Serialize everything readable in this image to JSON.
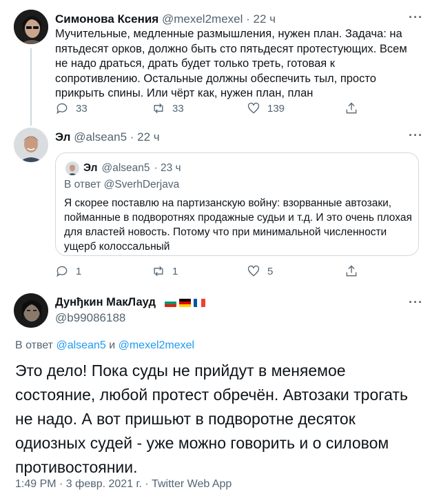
{
  "tweet1": {
    "name": "Симонова Ксения",
    "handle": "@mexel2mexel",
    "time": "· 22 ч",
    "more": "···",
    "text": "Мучительные, медленные размышления, нужен план. Задача: на пятьдесят орков, должно быть сто пятьдесят протестующих. Всем не надо драться, драть будет только треть, готовая к сопротивлению. Остальные должны обеспечить тыл, просто прикрыть спины. Или чёрт как, нужен план, план",
    "replies": "33",
    "retweets": "33",
    "likes": "139",
    "share": ""
  },
  "tweet2": {
    "name": "Эл",
    "handle": "@alsean5",
    "time": "· 22 ч",
    "more": "···",
    "quote": {
      "name": "Эл",
      "handle": "@alsean5",
      "time": "· 23 ч",
      "reply_to": "В ответ @SverhDerjava",
      "text": "Я скорее поставлю на партизанскую войну: взорванные автозаки, пойманные в подворотнях продажные судьи и т.д. И это очень плохая для властей новость. Потому что при минимальной численности ущерб колоссальный"
    },
    "replies": "1",
    "retweets": "1",
    "likes": "5"
  },
  "tweet3": {
    "name": "Дунђкин МакЛауд",
    "handle": "@b99086188",
    "more": "···",
    "reply_prefix": "В ответ",
    "reply_user1": "@alsean5",
    "reply_and": "и",
    "reply_user2": "@mexel2mexel",
    "text": "Это дело! Пока суды не прийдут в меняемое состояние, любой протест обречён. Автозаки трогать не надо. А вот пришьют в подворотне десяток одиозных судей - уже можно говорить и о силовом противостоянии.",
    "meta": "1:49 PM · 3 февр. 2021 г. · Twitter Web App"
  },
  "colors": {
    "text": "#0f1419",
    "muted": "#536471",
    "link": "#1d9bf0",
    "border": "#cfd9de"
  },
  "icons": {
    "reply": "speech-bubble-icon",
    "retweet": "retweet-arrows-icon",
    "like": "heart-icon",
    "share": "share-upload-icon",
    "more": "more-dots-icon",
    "flags": [
      "bulgaria-flag-icon",
      "germany-flag-icon",
      "france-flag-icon"
    ]
  }
}
